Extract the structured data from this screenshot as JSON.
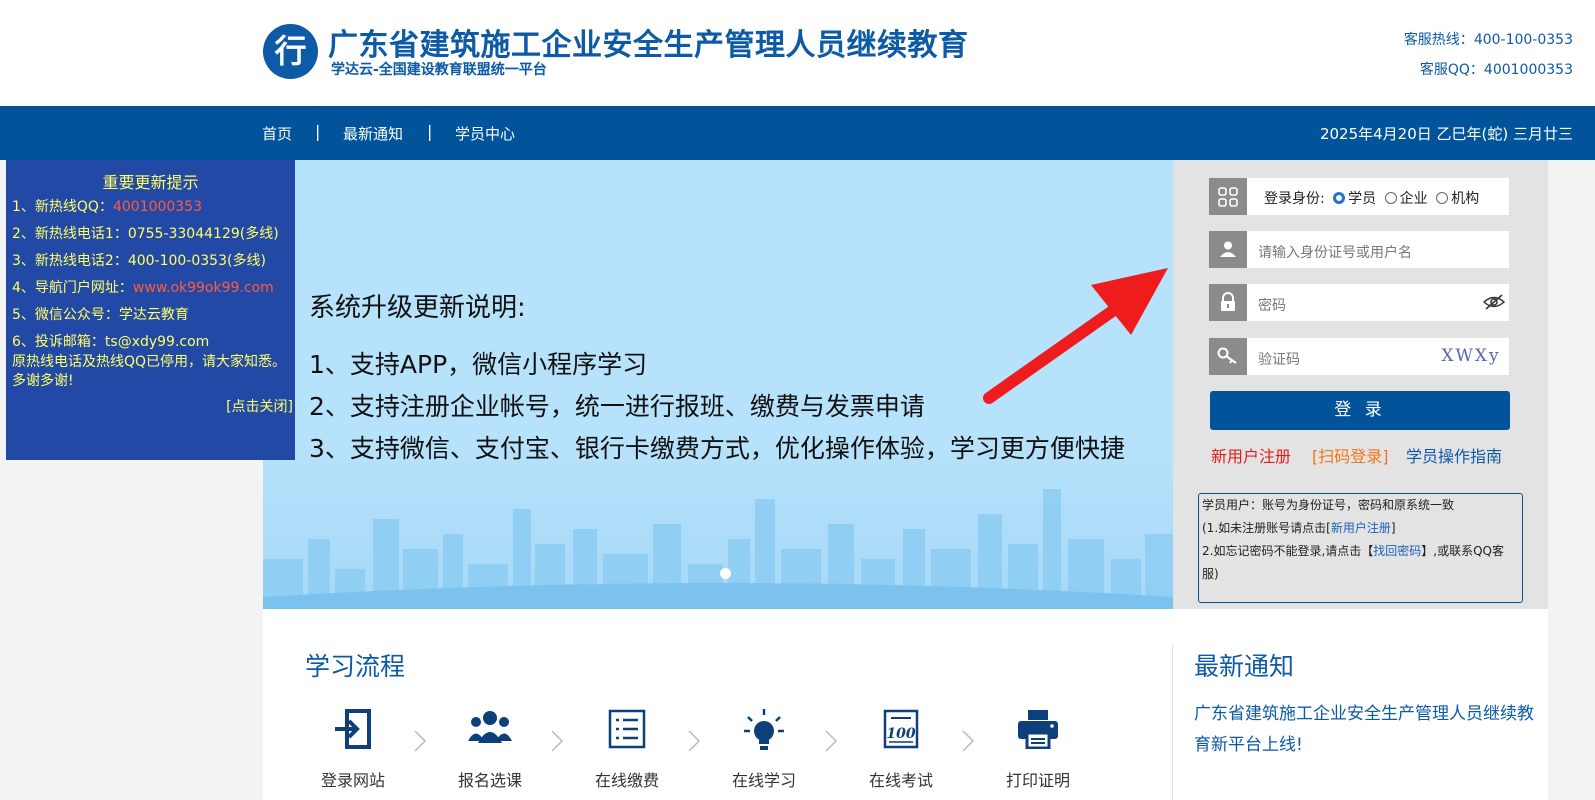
{
  "header": {
    "logo_char": "行",
    "title": "广东省建筑施工企业安全生产管理人员继续教育",
    "subtitle": "学达云-全国建设教育联盟统一平台",
    "hotline_label": "客服热线：",
    "hotline": "400-100-0353",
    "qq_label": "客服QQ：",
    "qq": "4001000353"
  },
  "nav": {
    "items": [
      "首页",
      "最新通知",
      "学员中心"
    ],
    "separator": "|",
    "date": "2025年4月20日 乙巳年(蛇) 三月廿三"
  },
  "notice": {
    "title": "重要更新提示",
    "lines": [
      {
        "label": "1、新热线QQ：",
        "value": "4001000353"
      },
      {
        "label": "2、新热线电话1：0755-33044129(多线)",
        "value": ""
      },
      {
        "label": "3、新热线电话2：400-100-0353(多线)",
        "value": ""
      },
      {
        "label": "4、导航门户网址：",
        "value": "www.ok99ok99.com"
      },
      {
        "label": "5、微信公众号：学达云教育",
        "value": ""
      },
      {
        "label": "6、投诉邮箱：ts@xdy99.com",
        "value": ""
      }
    ],
    "footer": "原热线电话及热线QQ已停用，请大家知悉。多谢多谢!",
    "close": "[点击关闭]"
  },
  "banner": {
    "heading": "系统升级更新说明:",
    "lines": [
      "1、支持APP，微信小程序学习",
      "2、支持注册企业帐号，统一进行报班、缴费与发票申请",
      "3、支持微信、支付宝、银行卡缴费方式，优化操作体验，学习更方便快捷"
    ]
  },
  "login": {
    "role_label": "登录身份:",
    "roles": [
      "学员",
      "企业",
      "机构"
    ],
    "selected_role": "学员",
    "username_placeholder": "请输入身份证号或用户名",
    "password_placeholder": "密码",
    "captcha_placeholder": "验证码",
    "captcha_text": "XWXy",
    "submit": "登 录",
    "links": [
      "新用户注册",
      "[扫码登录]",
      "学员操作指南"
    ],
    "link_colors": [
      "#e0201c",
      "#f07818",
      "#0d5aa7"
    ],
    "tip": {
      "line1": "学员用户：账号为身份证号，密码和原系统一致",
      "line2_pre": "(1.如未注册账号请点击[",
      "line2_link": "新用户注册",
      "line2_post": "]",
      "line3_pre": "2.如忘记密码不能登录,请点击【",
      "line3_link": "找回密码",
      "line3_post": "】,或联系QQ客服)"
    }
  },
  "process": {
    "title": "学习流程",
    "steps": [
      {
        "label": "登录网站",
        "icon": "login-icon"
      },
      {
        "label": "报名选课",
        "icon": "group-icon"
      },
      {
        "label": "在线缴费",
        "icon": "list-icon"
      },
      {
        "label": "在线学习",
        "icon": "bulb-icon"
      },
      {
        "label": "在线考试",
        "icon": "exam-icon"
      },
      {
        "label": "打印证明",
        "icon": "printer-icon"
      }
    ]
  },
  "news": {
    "title": "最新通知",
    "items": [
      "广东省建筑施工企业安全生产管理人员继续教育新平台上线!"
    ]
  },
  "colors": {
    "brand": "#02549a",
    "notice_bg": "#2349a7",
    "notice_text": "#ffff66"
  }
}
